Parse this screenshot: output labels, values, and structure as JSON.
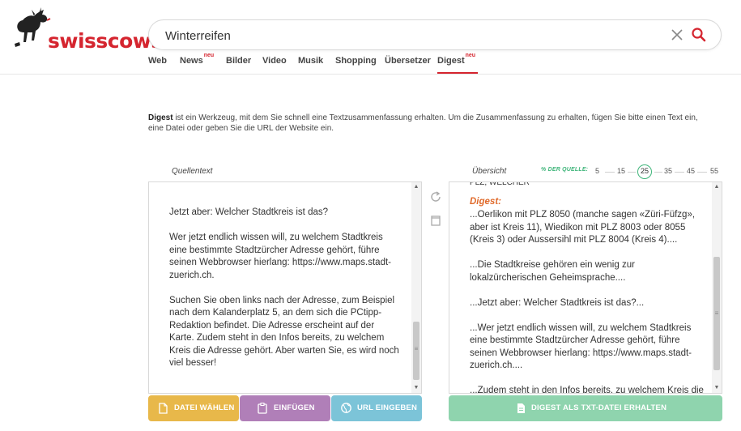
{
  "brand": {
    "logo_text": "swisscows",
    "color": "#d5252f"
  },
  "search": {
    "value": "Winterreifen",
    "clear_icon": "close-icon",
    "submit_icon": "search-icon"
  },
  "nav": {
    "items": [
      {
        "label": "Web",
        "badge": ""
      },
      {
        "label": "News",
        "badge": "neu"
      },
      {
        "label": "Bilder",
        "badge": ""
      },
      {
        "label": "Video",
        "badge": ""
      },
      {
        "label": "Musik",
        "badge": ""
      },
      {
        "label": "Shopping",
        "badge": ""
      },
      {
        "label": "Übersetzer",
        "badge": ""
      },
      {
        "label": "Digest",
        "badge": "neu",
        "active": true
      }
    ]
  },
  "intro": {
    "bold": "Digest",
    "text": " ist ein Werkzeug, mit dem Sie schnell eine Textzusammenfassung erhalten. Um die Zusammenfassung zu erhalten, fügen Sie bitte einen Text ein, eine Datei oder geben Sie die URL der Website ein."
  },
  "source": {
    "label": "Quellentext",
    "text": "Jetzt aber: Welcher Stadtkreis ist das?\n\nWer jetzt endlich wissen will, zu welchem Stadtkreis eine bestimmte Stadtzürcher Adresse gehört, führe seinen Webbrowser hierlang: https://www.maps.stadt-zuerich.ch.\n\nSuchen Sie oben links nach der Adresse, zum Beispiel nach dem Kalanderplatz 5, an dem sich die PCtipp-Redaktion befindet. Die Adresse erscheint auf der Karte. Zudem steht in den Infos bereits, zu welchem Kreis die Adresse gehört. Aber warten Sie, es wird noch viel besser!"
  },
  "overview": {
    "label": "Übersicht",
    "percent_label": "% DER QUELLE:",
    "scale": [
      "5",
      "15",
      "25",
      "35",
      "45",
      "55"
    ],
    "selected": "25",
    "accent": "#3fb57a",
    "cut_line": "PLZ, WELCHER",
    "digest_label": "Digest:",
    "text": "...Oerlikon mit PLZ 8050 (manche sagen «Züri-Füfzg», aber ist Kreis 11), Wiedikon mit PLZ 8003 oder 8055 (Kreis 3) oder Aussersihl mit PLZ 8004 (Kreis 4)....\n\n...Die Stadtkreise gehören ein wenig zur lokalzürcherischen Geheimsprache....\n\n...Jetzt aber: Welcher Stadtkreis ist das?...\n\n...Wer jetzt endlich wissen will, zu welchem Stadtkreis eine bestimmte Stadtzürcher Adresse gehört, führe seinen Webbrowser hierlang: https://www.maps.stadt-zuerich.ch....\n\n...Zudem steht in den Infos bereits, zu welchem Kreis die Adresse gehört...."
  },
  "tools": {
    "refresh_icon": "refresh-icon",
    "copy_icon": "copy-icon"
  },
  "buttons": {
    "file": {
      "label": "DATEI WÄHLEN",
      "color": "#e8b84a",
      "icon": "file-icon"
    },
    "paste": {
      "label": "EINFÜGEN",
      "color": "#b07fb8",
      "icon": "clipboard-icon"
    },
    "url": {
      "label": "URL EINGEBEN",
      "color": "#7cc4d8",
      "icon": "globe-icon"
    },
    "download": {
      "label": "DIGEST ALS TXT-DATEI ERHALTEN",
      "color": "#8fd4ae",
      "icon": "document-icon"
    }
  }
}
